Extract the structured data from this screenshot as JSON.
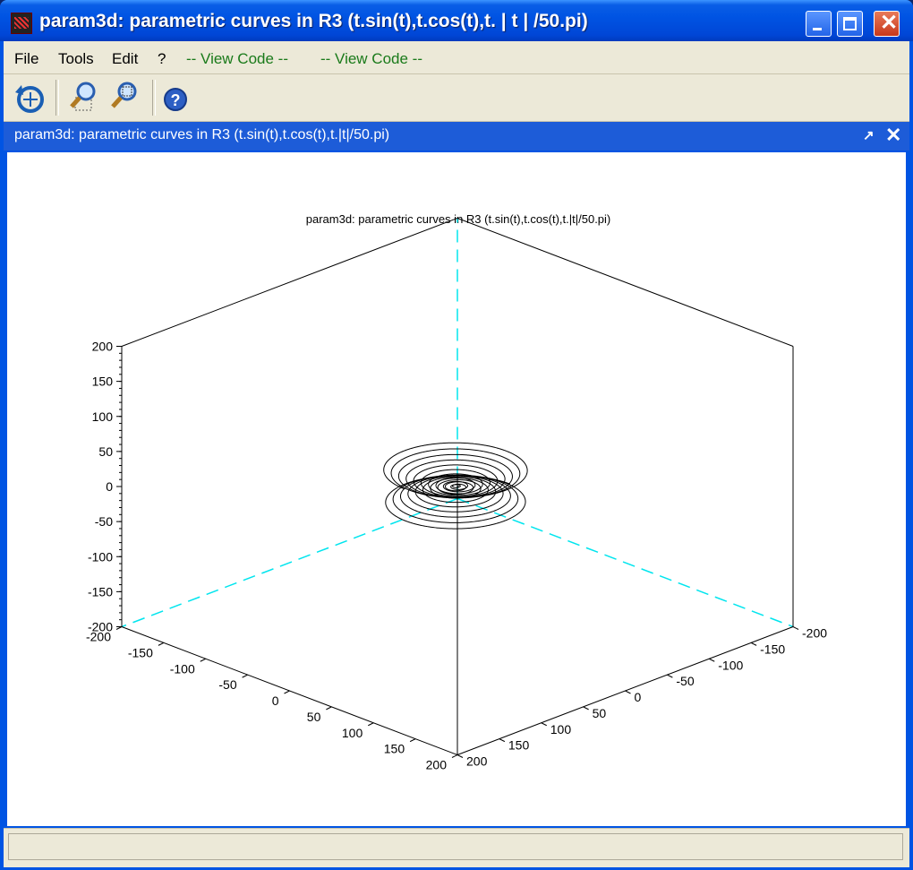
{
  "window": {
    "title": "param3d: parametric curves in R3 (t.sin(t),t.cos(t),t. | t | /50.pi)"
  },
  "menu": {
    "items": [
      "File",
      "Tools",
      "Edit",
      "?",
      "-- View Code --",
      "-- View Code --"
    ]
  },
  "toolbar": {
    "buttons": [
      "rotate-icon",
      "zoom-icon",
      "unzoom-icon",
      "help-icon"
    ]
  },
  "panel": {
    "title": "param3d: parametric curves in R3 (t.sin(t),t.cos(t),t.|t|/50.pi)",
    "undock_icon": "↗",
    "close_icon": "✕"
  },
  "colors": {
    "titlebar": "#0054e3",
    "panel_header": "#1d5cd8",
    "chrome": "#ece9d8",
    "curve": "#000000",
    "hidden_axes": "#00e5ee"
  },
  "chart_data": {
    "type": "line3d",
    "title": "param3d: parametric curves in R3 (t.sin(t),t.cos(t),t.|t|/50.pi)",
    "series": [
      {
        "x_expr": "t.sin(t)",
        "y_expr": "t.cos(t)",
        "z_expr": "t.|t|/50.pi"
      }
    ],
    "xlim": [
      -200,
      200
    ],
    "ylim": [
      -200,
      200
    ],
    "zlim": [
      -200,
      200
    ],
    "x_ticks": [
      "-200",
      "-150",
      "-100",
      "-50",
      "0",
      "50",
      "100",
      "150",
      "200"
    ],
    "y_ticks": [
      "-200",
      "-150",
      "-100",
      "-50",
      "0",
      "50",
      "100",
      "150",
      "200"
    ],
    "z_ticks": [
      "200",
      "150",
      "100",
      "50",
      "0",
      "-50",
      "-100",
      "-150",
      "-200"
    ],
    "box": true,
    "grid": false
  }
}
